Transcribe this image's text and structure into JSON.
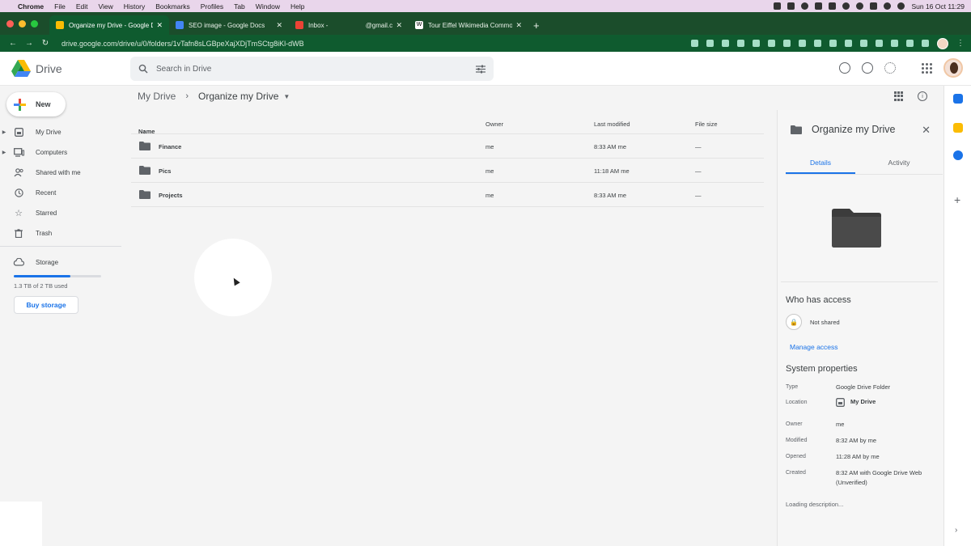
{
  "mac_menu": {
    "app": "Chrome",
    "items": [
      "File",
      "Edit",
      "View",
      "History",
      "Bookmarks",
      "Profiles",
      "Tab",
      "Window",
      "Help"
    ],
    "clock": "Sun 16 Oct  11:29"
  },
  "tabs": [
    {
      "title": "Organize my Drive - Google Dr",
      "color": "#1a73e8"
    },
    {
      "title": "SEO image - Google Docs",
      "color": "#4285f4"
    },
    {
      "title": "Inbox - ",
      "suffix": "@gmail.co",
      "color": "#ea4335"
    },
    {
      "title": "Tour Eiffel Wikimedia Commons",
      "color": "#ffffff"
    }
  ],
  "address": {
    "url": "drive.google.com/drive/u/0/folders/1vTafn8sLGBpeXajXDjTmSCtg8iKl-dWB"
  },
  "drive": {
    "logo_text": "Drive",
    "search_placeholder": "Search in Drive"
  },
  "sidebar": {
    "new_label": "New",
    "items": [
      {
        "label": "My Drive",
        "icon": "my-drive-icon",
        "caret": true
      },
      {
        "label": "Computers",
        "icon": "computer-icon",
        "caret": true
      },
      {
        "label": "Shared with me",
        "icon": "people-icon",
        "caret": false
      },
      {
        "label": "Recent",
        "icon": "clock-icon",
        "caret": false
      },
      {
        "label": "Starred",
        "icon": "star-icon",
        "caret": false
      },
      {
        "label": "Trash",
        "icon": "trash-icon",
        "caret": false
      }
    ],
    "storage_label": "Storage",
    "storage_used_text": "1.3 TB of 2 TB used",
    "storage_fraction": 0.65,
    "buy_storage": "Buy storage"
  },
  "breadcrumb": {
    "root": "My Drive",
    "current": "Organize my Drive"
  },
  "table": {
    "headers": {
      "name": "Name",
      "owner": "Owner",
      "modified": "Last modified",
      "size": "File size"
    },
    "rows": [
      {
        "name": "Finance",
        "owner": "me",
        "modified": "8:33 AM  me",
        "size": "—"
      },
      {
        "name": "Pics",
        "owner": "me",
        "modified": "11:18 AM  me",
        "size": "—"
      },
      {
        "name": "Projects",
        "owner": "me",
        "modified": "8:33 AM  me",
        "size": "—"
      }
    ]
  },
  "details": {
    "title": "Organize my Drive",
    "tab_details": "Details",
    "tab_activity": "Activity",
    "who_has_access": "Who has access",
    "not_shared": "Not shared",
    "manage_access": "Manage access",
    "system_properties": "System properties",
    "props": [
      {
        "label": "Type",
        "value": "Google Drive Folder"
      },
      {
        "label": "Location",
        "value": "My Drive"
      },
      {
        "label": "Owner",
        "value": "me"
      },
      {
        "label": "Modified",
        "value": "8:32 AM by me"
      },
      {
        "label": "Opened",
        "value": "11:28 AM by me"
      },
      {
        "label": "Created",
        "value": "8:32 AM with Google Drive Web (Unverified)"
      }
    ],
    "loading": "Loading description..."
  },
  "colors": {
    "accent": "#1a73e8",
    "chrome_dark": "#1b4d2b",
    "chrome_active": "#0f5b2f"
  }
}
